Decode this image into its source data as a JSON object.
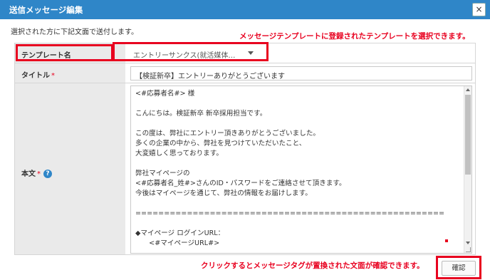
{
  "dialog": {
    "title": "送信メッセージ編集",
    "close_label": "×"
  },
  "instruction": "選択された方に下記文面で送付します。",
  "annotations": {
    "template_callout": "メッセージテンプレートに登録されたテンプレートを選択できます。",
    "confirm_callout": "クリックするとメッセージタグが置換された文面が確認できます。"
  },
  "form": {
    "template": {
      "label": "テンプレート名",
      "value": "エントリーサンクス(就活媒体…"
    },
    "title": {
      "label": "タイトル",
      "required_mark": "*",
      "value": "【検証新卒】エントリーありがとうございます"
    },
    "body": {
      "label": "本文",
      "required_mark": "*",
      "help_icon": "question-circle-icon",
      "lines": [
        "<#応募者名#> 様",
        "",
        "こんにちは。検証新卒 新卒採用担当です。",
        "",
        "この度は、弊社にエントリー頂きありがとうございました。",
        "多くの企業の中から、弊社を見つけていただいたこと、",
        "大変嬉しく思っております。",
        "",
        "弊社マイページの",
        "<#応募者名_姓#>さんのID・パスワードをご連絡させて頂きます。",
        "今後はマイページを通じて、弊社の情報をお届けします。",
        "",
        "======================================================",
        "",
        "◆マイページ ログインURL：",
        "　　<#マイページURL#>"
      ]
    }
  },
  "buttons": {
    "confirm": "確認"
  },
  "colors": {
    "titlebar": "#2f86c8",
    "annotation": "#e8001f"
  }
}
